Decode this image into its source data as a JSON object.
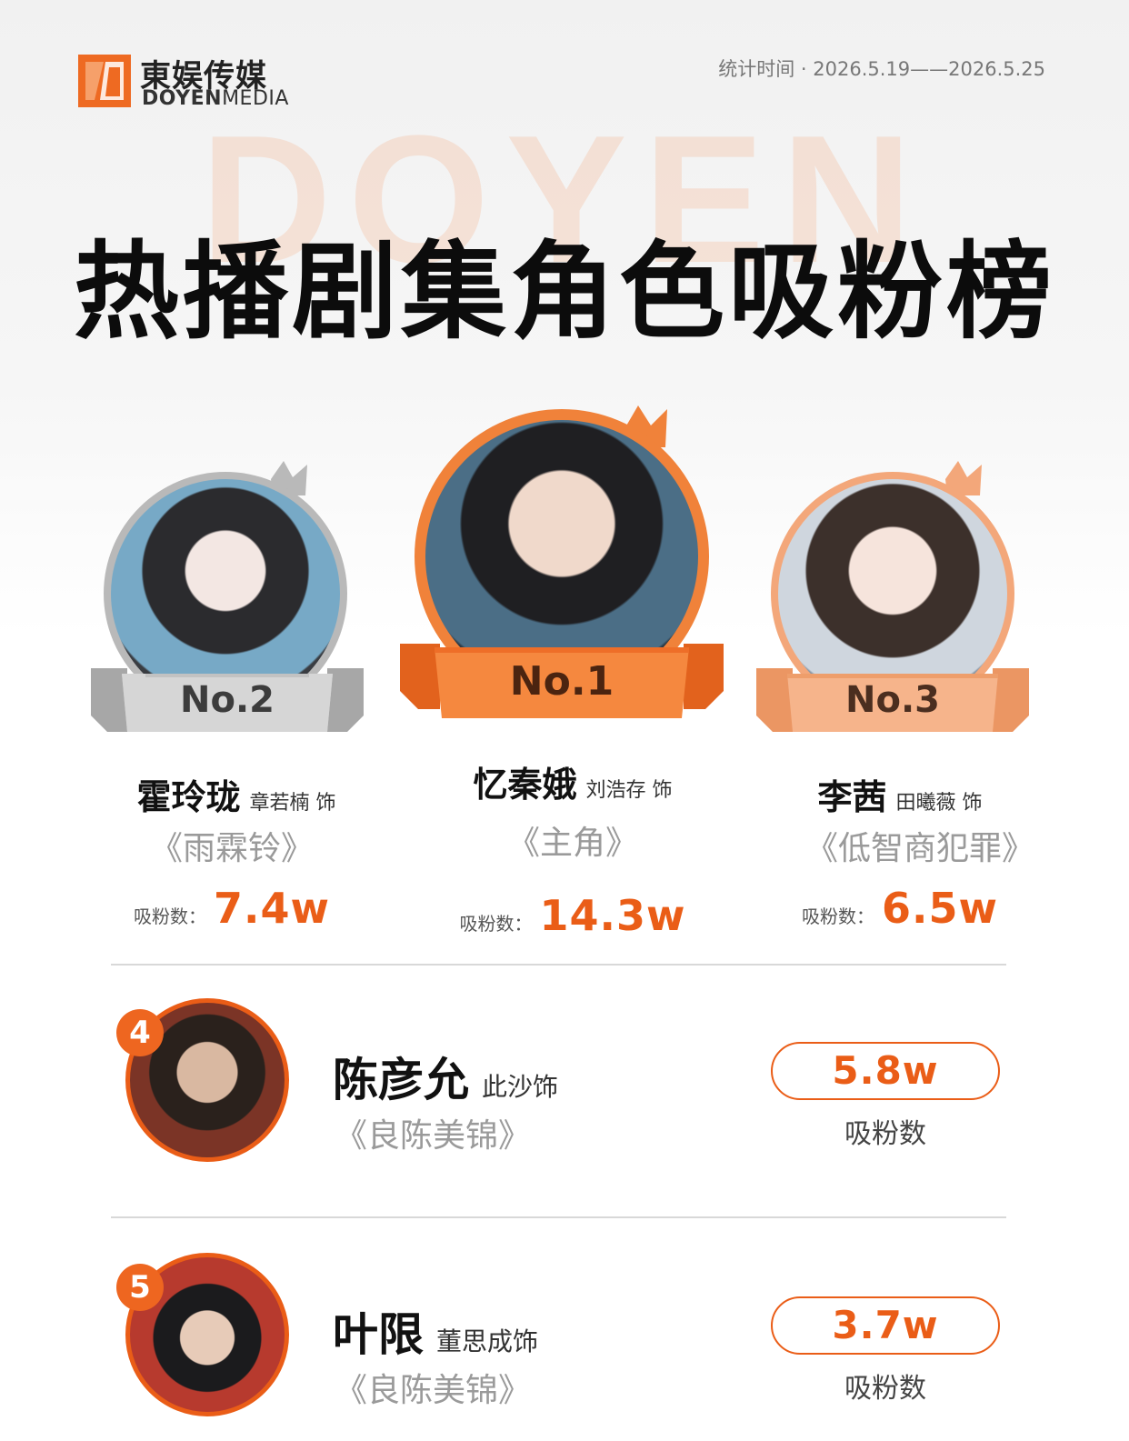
{
  "header": {
    "logo_cn": "東娱传媒",
    "logo_en_bold": "DOYEN",
    "logo_en_light": "MEDIA",
    "date_range": "统计时间 · 2026.5.19——2026.5.25"
  },
  "watermark": "DOYEN",
  "title": "热播剧集角色吸粉榜",
  "colors": {
    "accent": "#ea5d17",
    "gold": "#f0823a",
    "silver": "#b9b9b9",
    "bronze": "#f3a77a"
  },
  "podium": [
    {
      "rank_label": "No.1",
      "character": "忆秦娥",
      "actor": "刘浩存 饰",
      "drama": "《主角》",
      "fans_label": "吸粉数：",
      "fans": "14.3w"
    },
    {
      "rank_label": "No.2",
      "character": "霍玲珑",
      "actor": "章若楠 饰",
      "drama": "《雨霖铃》",
      "fans_label": "吸粉数：",
      "fans": "7.4w"
    },
    {
      "rank_label": "No.3",
      "character": "李茜",
      "actor": "田曦薇 饰",
      "drama": "《低智商犯罪》",
      "fans_label": "吸粉数：",
      "fans": "6.5w"
    }
  ],
  "list": [
    {
      "rank": "4",
      "character": "陈彦允",
      "actor": "此沙饰",
      "drama": "《良陈美锦》",
      "fans": "5.8w",
      "fans_label": "吸粉数"
    },
    {
      "rank": "5",
      "character": "叶限",
      "actor": "董思成饰",
      "drama": "《良陈美锦》",
      "fans": "3.7w",
      "fans_label": "吸粉数"
    }
  ]
}
